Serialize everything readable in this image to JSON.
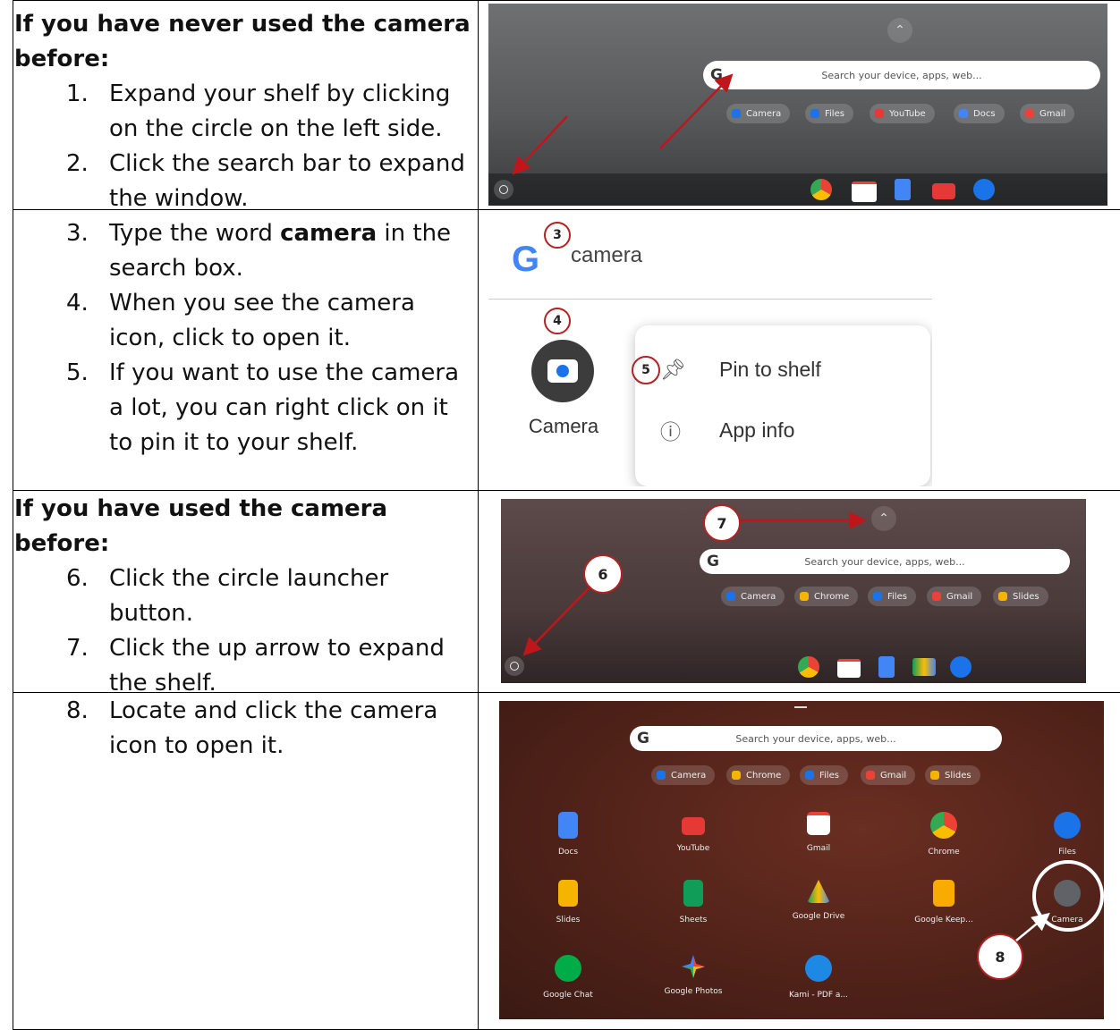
{
  "rows": [
    {
      "heading": "If you have never used the camera before:",
      "steps": [
        {
          "num": "1.",
          "text": "Expand your shelf by clicking on the circle on the left side."
        },
        {
          "num": "2.",
          "text": "Click the search bar to expand the window."
        }
      ]
    },
    {
      "heading": "",
      "steps": [
        {
          "num": "3.",
          "text_before": "Type the word ",
          "bold": "camera",
          "text_after": " in the search box."
        },
        {
          "num": "4.",
          "text": "When you see the camera icon, click to open it."
        },
        {
          "num": "5.",
          "text": "If you want to use the camera a lot, you can right click on it to pin it to your shelf."
        }
      ]
    },
    {
      "heading": "If you have used the camera before:",
      "steps": [
        {
          "num": "6.",
          "text": "Click the circle launcher button."
        },
        {
          "num": "7.",
          "text": "Click the up arrow to expand the shelf."
        }
      ]
    },
    {
      "heading": "",
      "steps": [
        {
          "num": "8.",
          "text": "Locate and click the camera icon to open it."
        }
      ]
    }
  ],
  "screens": {
    "search_placeholder": "Search your device, apps, web...",
    "search_g": "G",
    "chips1": [
      {
        "label": "Camera",
        "color": "#1a73e8"
      },
      {
        "label": "Files",
        "color": "#1a73e8"
      },
      {
        "label": "YouTube",
        "color": "#e53935"
      },
      {
        "label": "Docs",
        "color": "#4285f4"
      },
      {
        "label": "Gmail",
        "color": "#ea4335"
      }
    ],
    "chips2": [
      {
        "label": "Camera",
        "color": "#1a73e8"
      },
      {
        "label": "Chrome",
        "color": "#f4b400"
      },
      {
        "label": "Files",
        "color": "#1a73e8"
      },
      {
        "label": "Gmail",
        "color": "#ea4335"
      },
      {
        "label": "Slides",
        "color": "#f4b400"
      }
    ],
    "query": "camera",
    "app_label": "Camera",
    "menu_pin": "Pin to shelf",
    "menu_info": "App info",
    "callouts": [
      "3",
      "4",
      "5",
      "6",
      "7",
      "8"
    ],
    "apps": [
      {
        "label": "Docs",
        "color": "#4285f4"
      },
      {
        "label": "YouTube",
        "color": "#e53935"
      },
      {
        "label": "Gmail",
        "color": "#ea4335"
      },
      {
        "label": "Chrome",
        "color": "#34a853"
      },
      {
        "label": "Files",
        "color": "#1a73e8"
      },
      {
        "label": "Slides",
        "color": "#f4b400"
      },
      {
        "label": "Sheets",
        "color": "#0f9d58"
      },
      {
        "label": "Google Drive",
        "color": "#fbbc04"
      },
      {
        "label": "Google Keep...",
        "color": "#f9ab00"
      },
      {
        "label": "Camera",
        "color": "#5f6368"
      },
      {
        "label": "Google Chat",
        "color": "#00ac47"
      },
      {
        "label": "Google Photos",
        "color": "#ea4335"
      },
      {
        "label": "Kami - PDF a...",
        "color": "#1e88e5"
      }
    ]
  }
}
